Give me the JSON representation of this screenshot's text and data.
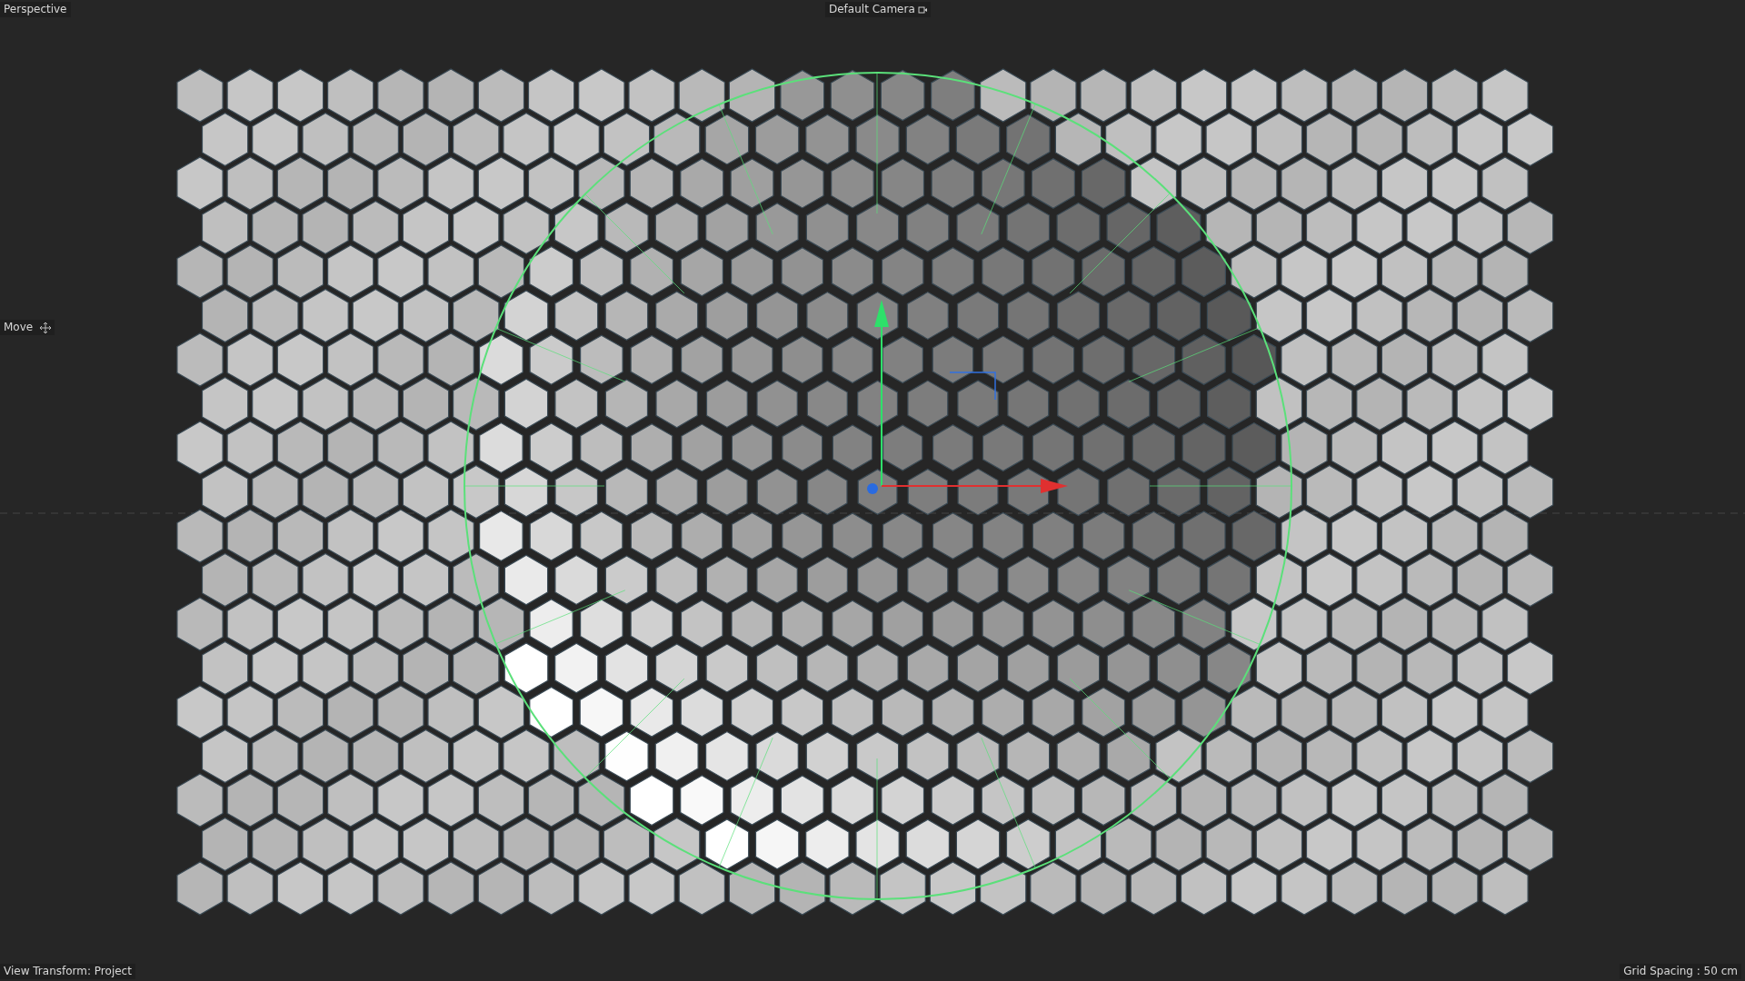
{
  "viewport": {
    "view_name": "Perspective",
    "camera": "Default Camera",
    "tool": "Move",
    "view_transform": "View Transform: Project",
    "grid_spacing": "Grid Spacing : 50 cm"
  }
}
